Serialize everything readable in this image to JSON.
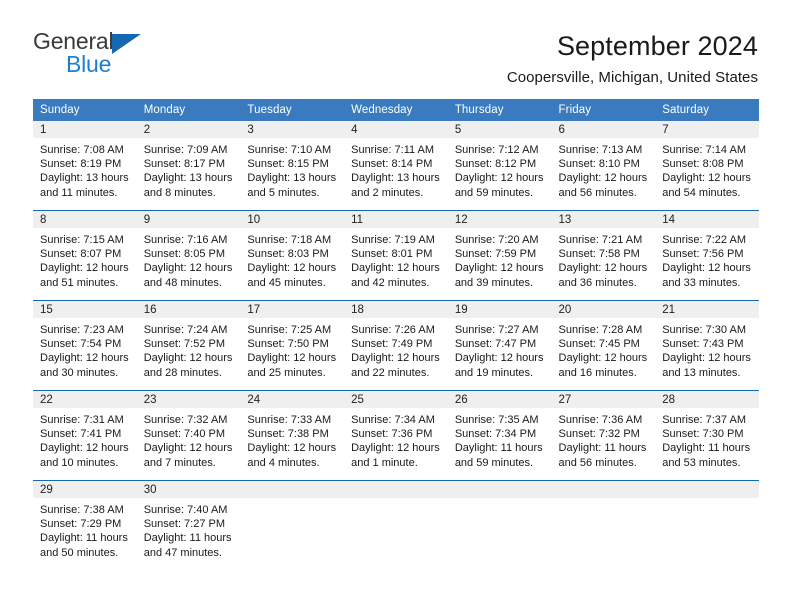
{
  "brand": {
    "name_top": "General",
    "name_bottom": "Blue",
    "triangle_color": "#1668b3",
    "blue_text_color": "#1b7fd1"
  },
  "header": {
    "title": "September 2024",
    "subtitle": "Coopersville, Michigan, United States"
  },
  "theme": {
    "header_bg": "#3a7bbf",
    "header_text": "#ffffff",
    "row_border": "#1668b3",
    "daynum_bg": "#efefef"
  },
  "calendar": {
    "weekdays": [
      "Sunday",
      "Monday",
      "Tuesday",
      "Wednesday",
      "Thursday",
      "Friday",
      "Saturday"
    ],
    "weeks": [
      [
        {
          "day": "1",
          "sunrise": "Sunrise: 7:08 AM",
          "sunset": "Sunset: 8:19 PM",
          "daylight1": "Daylight: 13 hours",
          "daylight2": "and 11 minutes."
        },
        {
          "day": "2",
          "sunrise": "Sunrise: 7:09 AM",
          "sunset": "Sunset: 8:17 PM",
          "daylight1": "Daylight: 13 hours",
          "daylight2": "and 8 minutes."
        },
        {
          "day": "3",
          "sunrise": "Sunrise: 7:10 AM",
          "sunset": "Sunset: 8:15 PM",
          "daylight1": "Daylight: 13 hours",
          "daylight2": "and 5 minutes."
        },
        {
          "day": "4",
          "sunrise": "Sunrise: 7:11 AM",
          "sunset": "Sunset: 8:14 PM",
          "daylight1": "Daylight: 13 hours",
          "daylight2": "and 2 minutes."
        },
        {
          "day": "5",
          "sunrise": "Sunrise: 7:12 AM",
          "sunset": "Sunset: 8:12 PM",
          "daylight1": "Daylight: 12 hours",
          "daylight2": "and 59 minutes."
        },
        {
          "day": "6",
          "sunrise": "Sunrise: 7:13 AM",
          "sunset": "Sunset: 8:10 PM",
          "daylight1": "Daylight: 12 hours",
          "daylight2": "and 56 minutes."
        },
        {
          "day": "7",
          "sunrise": "Sunrise: 7:14 AM",
          "sunset": "Sunset: 8:08 PM",
          "daylight1": "Daylight: 12 hours",
          "daylight2": "and 54 minutes."
        }
      ],
      [
        {
          "day": "8",
          "sunrise": "Sunrise: 7:15 AM",
          "sunset": "Sunset: 8:07 PM",
          "daylight1": "Daylight: 12 hours",
          "daylight2": "and 51 minutes."
        },
        {
          "day": "9",
          "sunrise": "Sunrise: 7:16 AM",
          "sunset": "Sunset: 8:05 PM",
          "daylight1": "Daylight: 12 hours",
          "daylight2": "and 48 minutes."
        },
        {
          "day": "10",
          "sunrise": "Sunrise: 7:18 AM",
          "sunset": "Sunset: 8:03 PM",
          "daylight1": "Daylight: 12 hours",
          "daylight2": "and 45 minutes."
        },
        {
          "day": "11",
          "sunrise": "Sunrise: 7:19 AM",
          "sunset": "Sunset: 8:01 PM",
          "daylight1": "Daylight: 12 hours",
          "daylight2": "and 42 minutes."
        },
        {
          "day": "12",
          "sunrise": "Sunrise: 7:20 AM",
          "sunset": "Sunset: 7:59 PM",
          "daylight1": "Daylight: 12 hours",
          "daylight2": "and 39 minutes."
        },
        {
          "day": "13",
          "sunrise": "Sunrise: 7:21 AM",
          "sunset": "Sunset: 7:58 PM",
          "daylight1": "Daylight: 12 hours",
          "daylight2": "and 36 minutes."
        },
        {
          "day": "14",
          "sunrise": "Sunrise: 7:22 AM",
          "sunset": "Sunset: 7:56 PM",
          "daylight1": "Daylight: 12 hours",
          "daylight2": "and 33 minutes."
        }
      ],
      [
        {
          "day": "15",
          "sunrise": "Sunrise: 7:23 AM",
          "sunset": "Sunset: 7:54 PM",
          "daylight1": "Daylight: 12 hours",
          "daylight2": "and 30 minutes."
        },
        {
          "day": "16",
          "sunrise": "Sunrise: 7:24 AM",
          "sunset": "Sunset: 7:52 PM",
          "daylight1": "Daylight: 12 hours",
          "daylight2": "and 28 minutes."
        },
        {
          "day": "17",
          "sunrise": "Sunrise: 7:25 AM",
          "sunset": "Sunset: 7:50 PM",
          "daylight1": "Daylight: 12 hours",
          "daylight2": "and 25 minutes."
        },
        {
          "day": "18",
          "sunrise": "Sunrise: 7:26 AM",
          "sunset": "Sunset: 7:49 PM",
          "daylight1": "Daylight: 12 hours",
          "daylight2": "and 22 minutes."
        },
        {
          "day": "19",
          "sunrise": "Sunrise: 7:27 AM",
          "sunset": "Sunset: 7:47 PM",
          "daylight1": "Daylight: 12 hours",
          "daylight2": "and 19 minutes."
        },
        {
          "day": "20",
          "sunrise": "Sunrise: 7:28 AM",
          "sunset": "Sunset: 7:45 PM",
          "daylight1": "Daylight: 12 hours",
          "daylight2": "and 16 minutes."
        },
        {
          "day": "21",
          "sunrise": "Sunrise: 7:30 AM",
          "sunset": "Sunset: 7:43 PM",
          "daylight1": "Daylight: 12 hours",
          "daylight2": "and 13 minutes."
        }
      ],
      [
        {
          "day": "22",
          "sunrise": "Sunrise: 7:31 AM",
          "sunset": "Sunset: 7:41 PM",
          "daylight1": "Daylight: 12 hours",
          "daylight2": "and 10 minutes."
        },
        {
          "day": "23",
          "sunrise": "Sunrise: 7:32 AM",
          "sunset": "Sunset: 7:40 PM",
          "daylight1": "Daylight: 12 hours",
          "daylight2": "and 7 minutes."
        },
        {
          "day": "24",
          "sunrise": "Sunrise: 7:33 AM",
          "sunset": "Sunset: 7:38 PM",
          "daylight1": "Daylight: 12 hours",
          "daylight2": "and 4 minutes."
        },
        {
          "day": "25",
          "sunrise": "Sunrise: 7:34 AM",
          "sunset": "Sunset: 7:36 PM",
          "daylight1": "Daylight: 12 hours",
          "daylight2": "and 1 minute."
        },
        {
          "day": "26",
          "sunrise": "Sunrise: 7:35 AM",
          "sunset": "Sunset: 7:34 PM",
          "daylight1": "Daylight: 11 hours",
          "daylight2": "and 59 minutes."
        },
        {
          "day": "27",
          "sunrise": "Sunrise: 7:36 AM",
          "sunset": "Sunset: 7:32 PM",
          "daylight1": "Daylight: 11 hours",
          "daylight2": "and 56 minutes."
        },
        {
          "day": "28",
          "sunrise": "Sunrise: 7:37 AM",
          "sunset": "Sunset: 7:30 PM",
          "daylight1": "Daylight: 11 hours",
          "daylight2": "and 53 minutes."
        }
      ],
      [
        {
          "day": "29",
          "sunrise": "Sunrise: 7:38 AM",
          "sunset": "Sunset: 7:29 PM",
          "daylight1": "Daylight: 11 hours",
          "daylight2": "and 50 minutes."
        },
        {
          "day": "30",
          "sunrise": "Sunrise: 7:40 AM",
          "sunset": "Sunset: 7:27 PM",
          "daylight1": "Daylight: 11 hours",
          "daylight2": "and 47 minutes."
        },
        {
          "day": "",
          "sunrise": "",
          "sunset": "",
          "daylight1": "",
          "daylight2": ""
        },
        {
          "day": "",
          "sunrise": "",
          "sunset": "",
          "daylight1": "",
          "daylight2": ""
        },
        {
          "day": "",
          "sunrise": "",
          "sunset": "",
          "daylight1": "",
          "daylight2": ""
        },
        {
          "day": "",
          "sunrise": "",
          "sunset": "",
          "daylight1": "",
          "daylight2": ""
        },
        {
          "day": "",
          "sunrise": "",
          "sunset": "",
          "daylight1": "",
          "daylight2": ""
        }
      ]
    ]
  }
}
